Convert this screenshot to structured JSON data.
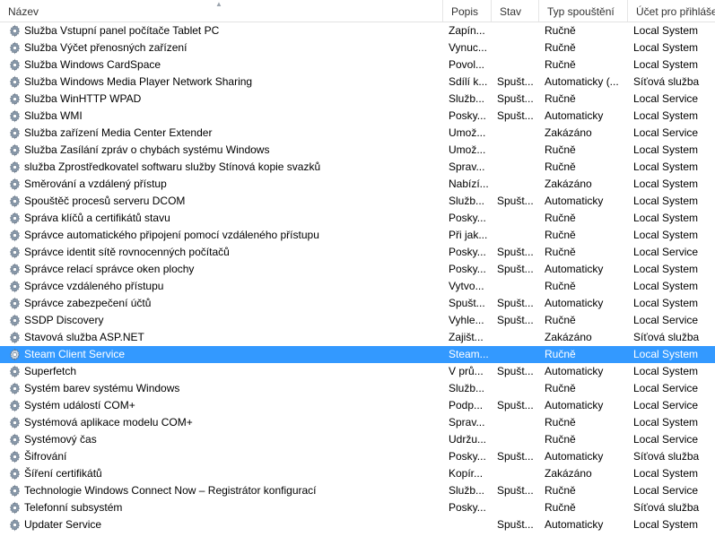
{
  "columns": {
    "name": "Název",
    "description": "Popis",
    "status": "Stav",
    "startup_type": "Typ spouštění",
    "logon_as": "Účet pro přihlášení"
  },
  "colors": {
    "selection": "#3399ff",
    "gear": "#8a9aab"
  },
  "services": [
    {
      "name": "Služba Vstupní panel počítače Tablet PC",
      "description": "Zapín...",
      "status": "",
      "startup": "Ručně",
      "logon": "Local System"
    },
    {
      "name": "Služba Výčet přenosných zařízení",
      "description": "Vynuc...",
      "status": "",
      "startup": "Ručně",
      "logon": "Local System"
    },
    {
      "name": "Služba Windows CardSpace",
      "description": "Povol...",
      "status": "",
      "startup": "Ručně",
      "logon": "Local System"
    },
    {
      "name": "Služba Windows Media Player Network Sharing",
      "description": "Sdílí k...",
      "status": "Spušt...",
      "startup": "Automaticky (...",
      "logon": "Síťová služba"
    },
    {
      "name": "Služba WinHTTP WPAD",
      "description": "Služb...",
      "status": "Spušt...",
      "startup": "Ručně",
      "logon": "Local Service"
    },
    {
      "name": "Služba WMI",
      "description": "Posky...",
      "status": "Spušt...",
      "startup": "Automaticky",
      "logon": "Local System"
    },
    {
      "name": "Služba zařízení Media Center Extender",
      "description": "Umož...",
      "status": "",
      "startup": "Zakázáno",
      "logon": "Local Service"
    },
    {
      "name": "Služba Zasílání zpráv o chybách systému Windows",
      "description": "Umož...",
      "status": "",
      "startup": "Ručně",
      "logon": "Local System"
    },
    {
      "name": "služba Zprostředkovatel softwaru služby Stínová kopie svazků",
      "description": "Sprav...",
      "status": "",
      "startup": "Ručně",
      "logon": "Local System"
    },
    {
      "name": "Směrování a vzdálený přístup",
      "description": "Nabízí...",
      "status": "",
      "startup": "Zakázáno",
      "logon": "Local System"
    },
    {
      "name": "Spouštěč procesů serveru DCOM",
      "description": "Služb...",
      "status": "Spušt...",
      "startup": "Automaticky",
      "logon": "Local System"
    },
    {
      "name": "Správa klíčů a certifikátů stavu",
      "description": "Posky...",
      "status": "",
      "startup": "Ručně",
      "logon": "Local System"
    },
    {
      "name": "Správce automatického připojení pomocí vzdáleného přístupu",
      "description": "Při jak...",
      "status": "",
      "startup": "Ručně",
      "logon": "Local System"
    },
    {
      "name": "Správce identit sítě rovnocenných počítačů",
      "description": "Posky...",
      "status": "Spušt...",
      "startup": "Ručně",
      "logon": "Local Service"
    },
    {
      "name": "Správce relací správce oken plochy",
      "description": "Posky...",
      "status": "Spušt...",
      "startup": "Automaticky",
      "logon": "Local System"
    },
    {
      "name": "Správce vzdáleného přístupu",
      "description": "Vytvo...",
      "status": "",
      "startup": "Ručně",
      "logon": "Local System"
    },
    {
      "name": "Správce zabezpečení účtů",
      "description": "Spušt...",
      "status": "Spušt...",
      "startup": "Automaticky",
      "logon": "Local System"
    },
    {
      "name": "SSDP Discovery",
      "description": "Vyhle...",
      "status": "Spušt...",
      "startup": "Ručně",
      "logon": "Local Service"
    },
    {
      "name": "Stavová služba ASP.NET",
      "description": "Zajišt...",
      "status": "",
      "startup": "Zakázáno",
      "logon": "Síťová služba"
    },
    {
      "name": "Steam Client Service",
      "description": "Steam...",
      "status": "",
      "startup": "Ručně",
      "logon": "Local System",
      "selected": true
    },
    {
      "name": "Superfetch",
      "description": "V prů...",
      "status": "Spušt...",
      "startup": "Automaticky",
      "logon": "Local System"
    },
    {
      "name": "Systém barev systému Windows",
      "description": "Služb...",
      "status": "",
      "startup": "Ručně",
      "logon": "Local Service"
    },
    {
      "name": "Systém událostí COM+",
      "description": "Podp...",
      "status": "Spušt...",
      "startup": "Automaticky",
      "logon": "Local Service"
    },
    {
      "name": "Systémová aplikace modelu COM+",
      "description": "Sprav...",
      "status": "",
      "startup": "Ručně",
      "logon": "Local System"
    },
    {
      "name": "Systémový čas",
      "description": "Udržu...",
      "status": "",
      "startup": "Ručně",
      "logon": "Local Service"
    },
    {
      "name": "Šifrování",
      "description": "Posky...",
      "status": "Spušt...",
      "startup": "Automaticky",
      "logon": "Síťová služba"
    },
    {
      "name": "Šíření certifikátů",
      "description": "Kopír...",
      "status": "",
      "startup": "Zakázáno",
      "logon": "Local System"
    },
    {
      "name": "Technologie Windows Connect Now – Registrátor konfigurací",
      "description": "Služb...",
      "status": "Spušt...",
      "startup": "Ručně",
      "logon": "Local Service"
    },
    {
      "name": "Telefonní subsystém",
      "description": "Posky...",
      "status": "",
      "startup": "Ručně",
      "logon": "Síťová služba"
    },
    {
      "name": "Updater Service",
      "description": "",
      "status": "Spušt...",
      "startup": "Automaticky",
      "logon": "Local System"
    }
  ]
}
